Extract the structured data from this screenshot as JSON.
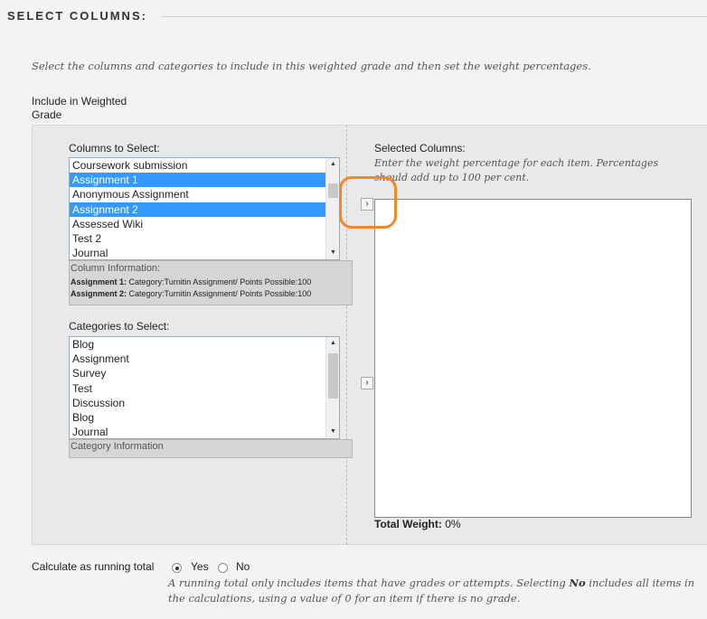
{
  "header": {
    "title": "SELECT COLUMNS:"
  },
  "instructions": "Select the columns and categories to include in this weighted grade and then set the weight percentages.",
  "include_label": "Include in Weighted Grade",
  "columns": {
    "label": "Columns to Select:",
    "items": [
      {
        "label": "Coursework submission",
        "selected": false
      },
      {
        "label": "Assignment 1",
        "selected": true
      },
      {
        "label": "Anonymous Assignment",
        "selected": false
      },
      {
        "label": "Assignment 2",
        "selected": true
      },
      {
        "label": "Assessed Wiki",
        "selected": false
      },
      {
        "label": "Test 2",
        "selected": false
      },
      {
        "label": "Journal",
        "selected": false
      }
    ],
    "info_title": "Column Information:",
    "info_lines": [
      {
        "name": "Assignment 1:",
        "detail": "Category:Turnitin Assignment/ Points Possible:100"
      },
      {
        "name": "Assignment 2:",
        "detail": "Category:Turnitin Assignment/ Points Possible:100"
      }
    ]
  },
  "categories": {
    "label": "Categories to Select:",
    "items": [
      "Blog",
      "Assignment",
      "Survey",
      "Test",
      "Discussion",
      "Blog",
      "Journal"
    ],
    "info_title": "Category Information"
  },
  "add_button_glyph": "›",
  "selected": {
    "label": "Selected Columns:",
    "hint": "Enter the weight percentage for each item. Percentages should add up to 100 per cent.",
    "total_label": "Total Weight:",
    "total_value": "0%"
  },
  "running_total": {
    "label": "Calculate as running total",
    "yes_label": "Yes",
    "no_label": "No",
    "selected": "Yes",
    "note_before": "A running total only includes items that have grades or attempts. Selecting ",
    "note_bold": "No",
    "note_after": " includes all items in the calculations, using a value of 0 for an item if there is no grade."
  },
  "colors": {
    "selection": "#3399ff",
    "highlight_ring": "#f0882a"
  }
}
